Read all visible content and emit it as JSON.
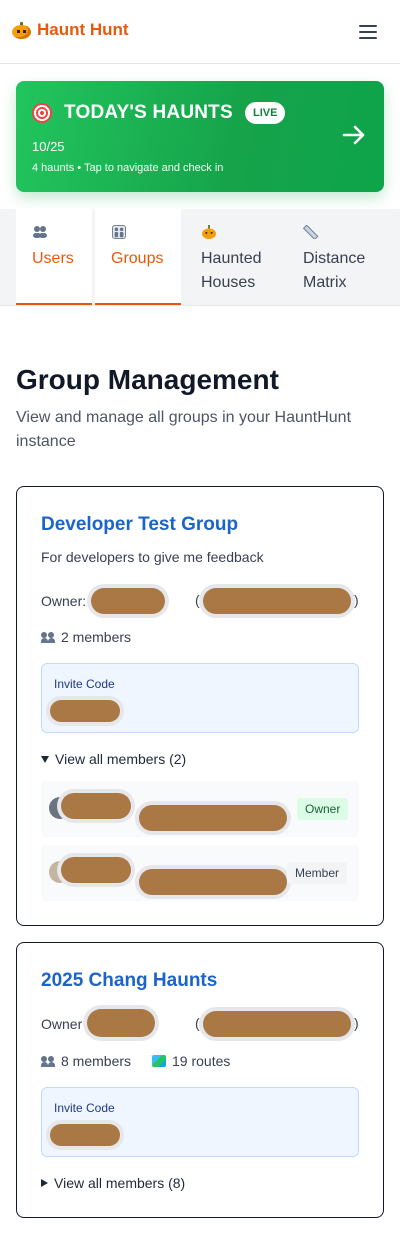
{
  "app": {
    "name": "Haunt Hunt"
  },
  "banner": {
    "title": "TODAY'S HAUNTS",
    "badge": "LIVE",
    "date": "10/25",
    "subtitle": "4 haunts • Tap to navigate and check in"
  },
  "tabs": [
    {
      "label": "Users",
      "icon": "people-icon"
    },
    {
      "label": "Groups",
      "icon": "groups-icon"
    },
    {
      "label": "Haunted Houses",
      "icon": "pumpkin-icon"
    },
    {
      "label": "Distance Matrix",
      "icon": "ruler-icon"
    }
  ],
  "page": {
    "title": "Group Management",
    "description": "View and manage all groups in your HauntHunt instance"
  },
  "groups": [
    {
      "name": "Developer Test Group",
      "description": "For developers to give me feedback",
      "owner_label": "Owner:",
      "members_count": "2 members",
      "invite_label": "Invite Code",
      "members_toggle": "View all members (2)",
      "members": [
        {
          "role": "Owner"
        },
        {
          "role": "Member"
        }
      ]
    },
    {
      "name": "2025 Chang Haunts",
      "owner_label": "Owner",
      "members_count": "8 members",
      "routes_count": "19 routes",
      "invite_label": "Invite Code",
      "members_toggle": "View all members (8)"
    }
  ],
  "colors": {
    "brand": "#ea580c",
    "banner": "#16a34a",
    "link": "#1d64c8",
    "redaction": "#a97844"
  }
}
